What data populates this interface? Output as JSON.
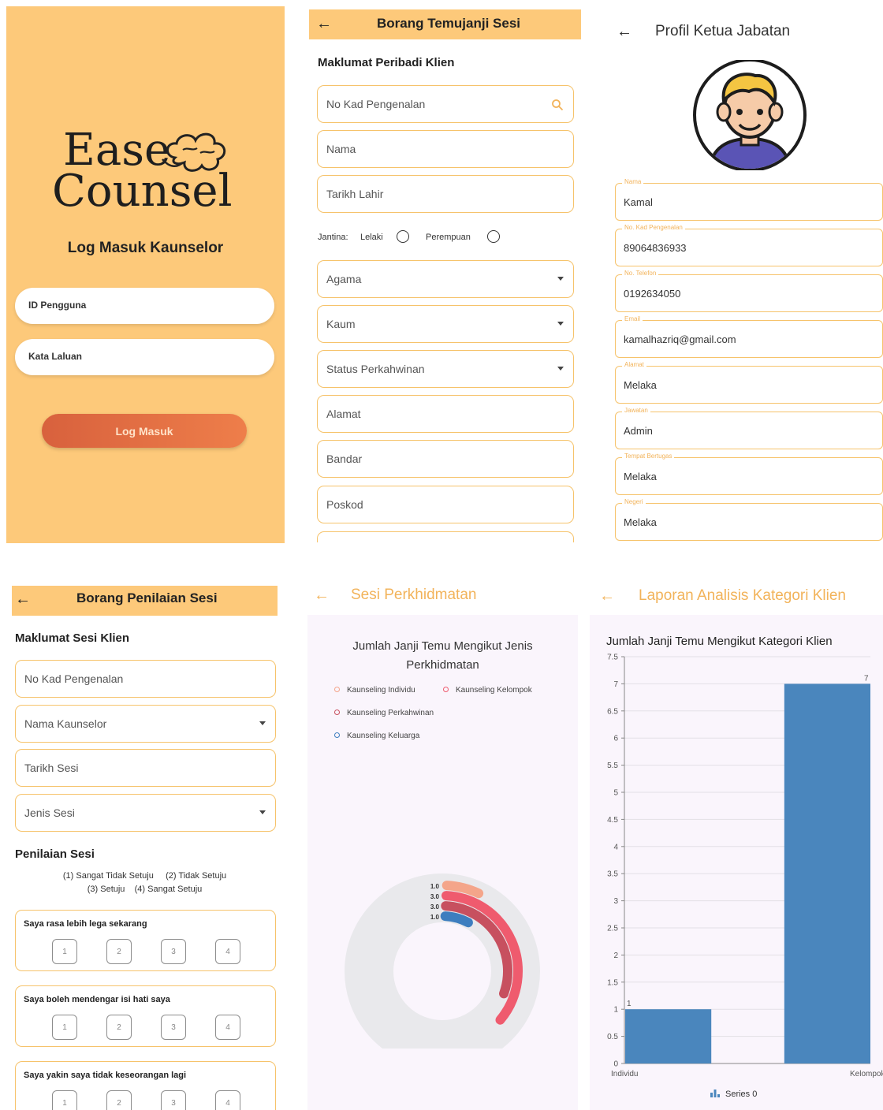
{
  "login": {
    "logo_line1": "Ease",
    "logo_line2": "Counsel",
    "title": "Log Masuk Kaunselor",
    "user_id_label": "ID Pengguna",
    "password_label": "Kata Laluan",
    "login_button": "Log Masuk"
  },
  "appointment_form": {
    "title": "Borang Temujanji Sesi",
    "section": "Maklumat Peribadi Klien",
    "ic_placeholder": "No Kad Pengenalan",
    "name_placeholder": "Nama",
    "dob_placeholder": "Tarikh Lahir",
    "gender_label": "Jantina:",
    "gender_male": "Lelaki",
    "gender_female": "Perempuan",
    "religion_placeholder": "Agama",
    "race_placeholder": "Kaum",
    "marital_placeholder": "Status Perkahwinan",
    "address_placeholder": "Alamat",
    "city_placeholder": "Bandar",
    "postcode_placeholder": "Poskod"
  },
  "profile": {
    "title": "Profil Ketua Jabatan",
    "fields": [
      {
        "label": "Nama",
        "value": "Kamal"
      },
      {
        "label": "No. Kad Pengenalan",
        "value": "89064836933"
      },
      {
        "label": "No. Telefon",
        "value": "0192634050"
      },
      {
        "label": "Email",
        "value": "kamalhazriq@gmail.com"
      },
      {
        "label": "Alamat",
        "value": "Melaka"
      },
      {
        "label": "Jawatan",
        "value": "Admin"
      },
      {
        "label": "Tempat Bertugas",
        "value": "Melaka"
      },
      {
        "label": "Negeri",
        "value": "Melaka"
      }
    ]
  },
  "evaluation_form": {
    "title": "Borang Penilaian Sesi",
    "section": "Maklumat Sesi Klien",
    "ic_placeholder": "No Kad Pengenalan",
    "counselor_placeholder": "Nama Kaunselor",
    "date_placeholder": "Tarikh Sesi",
    "type_placeholder": "Jenis Sesi",
    "rating_section": "Penilaian Sesi",
    "scale_line1": "(1) Sangat Tidak Setuju     (2) Tidak Setuju",
    "scale_line2": "(3) Setuju    (4) Sangat Setuju",
    "questions": [
      "Saya rasa lebih lega sekarang",
      "Saya boleh mendengar isi hati saya",
      "Saya yakin saya tidak keseorangan lagi"
    ],
    "options": [
      "1",
      "2",
      "3",
      "4"
    ]
  },
  "services": {
    "title": "Sesi Perkhidmatan",
    "chart_title_line1": "Jumlah Janji Temu Mengikut Jenis",
    "chart_title_line2": "Perkhidmatan",
    "colors": [
      "#f4a58a",
      "#ef5b6e",
      "#c7505f",
      "#3d7ebf"
    ]
  },
  "report": {
    "title": "Laporan Analisis Kategori Klien",
    "legend": "Series 0",
    "bar_color": "#4a86bd"
  },
  "chart_data": [
    {
      "type": "pie",
      "title": "Jumlah Janji Temu Mengikut Jenis Perkhidmatan",
      "categories": [
        "Kaunseling Individu",
        "Kaunseling Kelompok",
        "Kaunseling Perkahwinan",
        "Kaunseling Keluarga"
      ],
      "data_labels": [
        "1.0",
        "3.0",
        "3.0",
        "1.0"
      ],
      "legend": "top-left"
    },
    {
      "type": "bar",
      "title": "Jumlah Janji Temu Mengikut Kategori Klien",
      "categories": [
        "Individu",
        "Kelompok"
      ],
      "values": [
        1,
        7
      ],
      "series": [
        {
          "name": "Series 0",
          "values": [
            1,
            7
          ]
        }
      ],
      "ylim": [
        0,
        7.5
      ],
      "yticks": [
        "0",
        "0.5",
        "1",
        "1.5",
        "2",
        "2.5",
        "3",
        "3.5",
        "4",
        "4.5",
        "5",
        "5.5",
        "6",
        "6.5",
        "7",
        "7.5"
      ],
      "grid": true,
      "legend": "bottom-center"
    }
  ]
}
